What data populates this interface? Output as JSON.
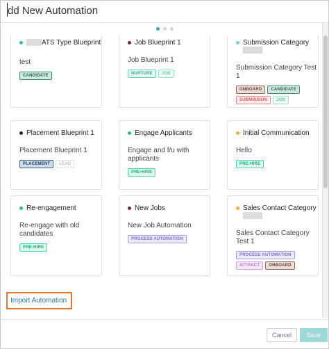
{
  "modal": {
    "title": "dd New Automation",
    "steps": [
      true,
      false,
      false
    ]
  },
  "cards": [
    {
      "name": "ATS Type Blueprint",
      "name_redacted_prefix": true,
      "bullet_color": "#2bbfa4",
      "description": "test",
      "tags": [
        {
          "label": "CANDIDATE",
          "style": "candidate"
        }
      ]
    },
    {
      "name": "Job Blueprint 1",
      "bullet_color": "#6e2a2a",
      "description": "Job Blueprint 1",
      "tags": [
        {
          "label": "NURTURE",
          "style": "nurture"
        },
        {
          "label": "JOB",
          "style": "job"
        }
      ]
    },
    {
      "name": "Submission Category",
      "name_redacted_suffix": true,
      "bullet_color": "#7ec8ea",
      "description": "Submission Category Test 1",
      "tags": [
        {
          "label": "ONBOARD",
          "style": "onboard"
        },
        {
          "label": "CANDIDATE",
          "style": "candidate"
        },
        {
          "label": "SUBMISSION",
          "style": "submission"
        },
        {
          "label": "JOB",
          "style": "job"
        }
      ]
    },
    {
      "name": "Placement Blueprint 1",
      "bullet_color": "#1f2d3d",
      "description": "Placement Blueprint 1",
      "tags": [
        {
          "label": "PLACEMENT",
          "style": "placement"
        },
        {
          "label": "LEAD",
          "style": "lead"
        }
      ]
    },
    {
      "name": "Engage Applicants",
      "bullet_color": "#2bbfa4",
      "description": "Engage and f/u with applicants",
      "tags": [
        {
          "label": "PRE-HIRE",
          "style": "prehire"
        }
      ]
    },
    {
      "name": "Initial Communication",
      "bullet_color": "#f2b233",
      "description": "Hello",
      "tags": [
        {
          "label": "PRE-HIRE",
          "style": "prehire"
        }
      ]
    },
    {
      "name": "Re-engagement",
      "bullet_color": "#2bbfa4",
      "description": "Re-engage with old candidates",
      "tags": [
        {
          "label": "PRE-HIRE",
          "style": "prehire"
        }
      ]
    },
    {
      "name": "New Jobs",
      "bullet_color": "#6e2a2a",
      "description": "New Job Automation",
      "tags": [
        {
          "label": "PROCESS AUTOMATION",
          "style": "process"
        }
      ]
    },
    {
      "name": "Sales Contact Category",
      "name_redacted_suffix": true,
      "bullet_color": "#f2b233",
      "description": "Sales Contact Category Test 1",
      "tags": [
        {
          "label": "PROCESS AUTOMATION",
          "style": "process"
        },
        {
          "label": "ATTRACT",
          "style": "attract"
        },
        {
          "label": "ONBOARD",
          "style": "onboard"
        }
      ]
    }
  ],
  "tag_styles": {
    "candidate": {
      "bg": "#cfe9e0",
      "border": "#3a8c73",
      "color": "#24604e"
    },
    "nurture": {
      "bg": "#e6f7f4",
      "border": "#6fd1c0",
      "color": "#3fa897"
    },
    "job": {
      "bg": "#effdf7",
      "border": "#9fe6c7",
      "color": "#6ccaa2"
    },
    "onboard": {
      "bg": "#ecdcd6",
      "border": "#8c6a5e",
      "color": "#5e4238"
    },
    "submission": {
      "bg": "#fdecec",
      "border": "#f08c8c",
      "color": "#e26060"
    },
    "placement": {
      "bg": "#cfdcea",
      "border": "#3d5f86",
      "color": "#213a58"
    },
    "lead": {
      "bg": "#ffffff",
      "border": "#dcdcdc",
      "color": "#bdbdbd"
    },
    "prehire": {
      "bg": "#dcf9ef",
      "border": "#48d9a8",
      "color": "#1ea77a"
    },
    "process": {
      "bg": "#ece9fb",
      "border": "#a79ee4",
      "color": "#7b6fd0"
    },
    "attract": {
      "bg": "#f5e8fb",
      "border": "#d3a5ec",
      "color": "#b173d8"
    }
  },
  "import_link": "Import Automation",
  "footer": {
    "cancel": "Cancel",
    "save": "Save"
  }
}
